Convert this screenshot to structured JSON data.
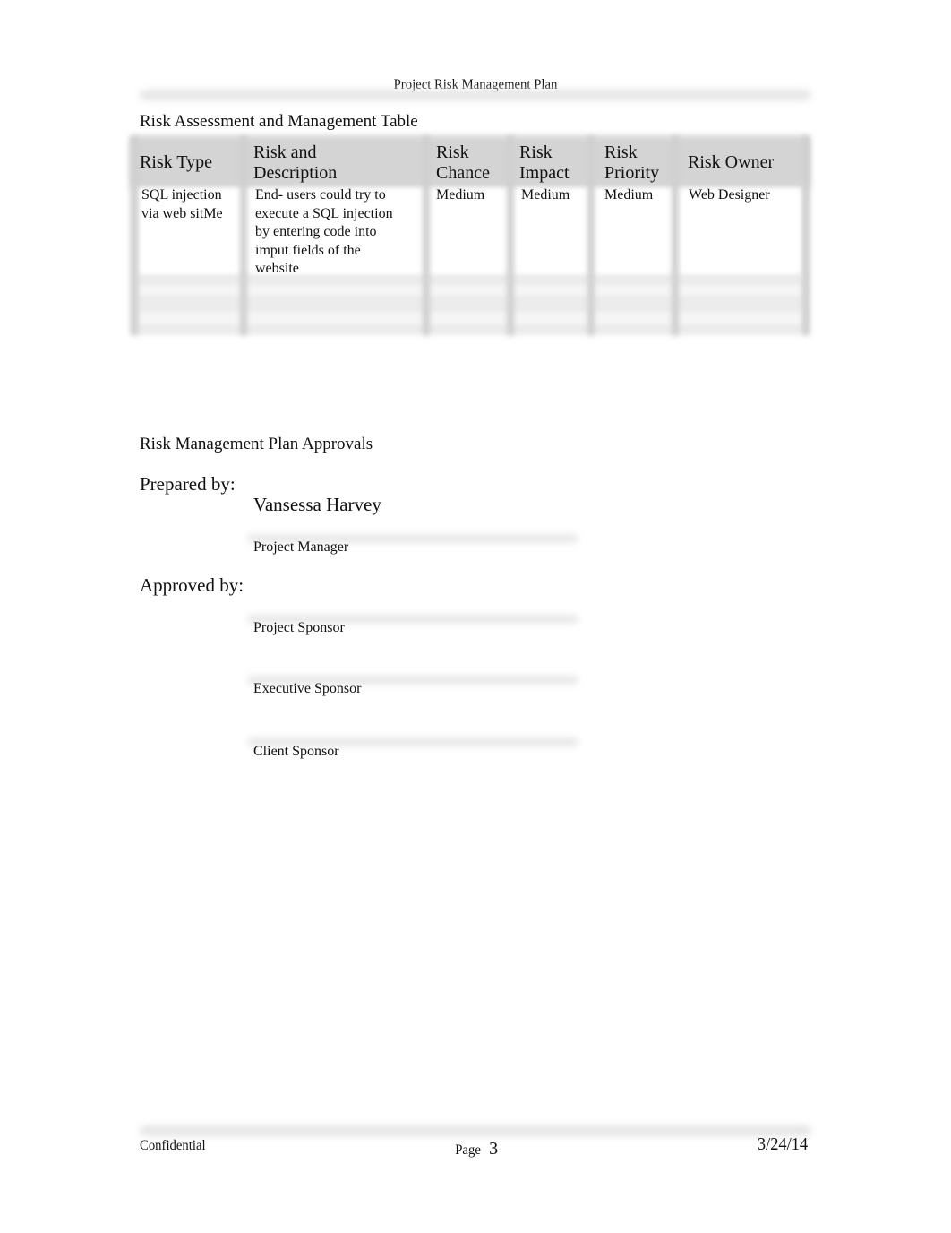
{
  "header": {
    "title": "Project Risk Management Plan"
  },
  "risk_table": {
    "title": "Risk Assessment and Management Table",
    "columns": [
      {
        "line1": "Risk Type",
        "line2": ""
      },
      {
        "line1": "Risk and",
        "line2": "Description"
      },
      {
        "line1": "Risk",
        "line2": "Chance"
      },
      {
        "line1": "Risk",
        "line2": "Impact"
      },
      {
        "line1": "Risk",
        "line2": "Priority"
      },
      {
        "line1": "Risk Owner",
        "line2": ""
      }
    ],
    "rows": [
      {
        "risk_type": [
          "SQL injection",
          "via web sitMe"
        ],
        "description": [
          "End- users could try to",
          "execute a SQL injection",
          "by entering code into",
          "imput fields of the",
          "website"
        ],
        "chance": "Medium",
        "impact": "Medium",
        "priority": "Medium",
        "owner": "Web Designer"
      },
      {
        "risk_type": [],
        "description": [],
        "chance": "",
        "impact": "",
        "priority": "",
        "owner": ""
      },
      {
        "risk_type": [],
        "description": [],
        "chance": "",
        "impact": "",
        "priority": "",
        "owner": ""
      }
    ]
  },
  "approvals": {
    "title": "Risk Management Plan Approvals",
    "prepared_by_label": "Prepared by:",
    "prepared_by_name": "Vansessa Harvey",
    "prepared_by_role": "Project Manager",
    "approved_by_label": "Approved by:",
    "signatories": [
      {
        "role": "Project Sponsor"
      },
      {
        "role": "Executive Sponsor"
      },
      {
        "role": "Client Sponsor"
      }
    ]
  },
  "footer": {
    "left": "Confidential",
    "page_label": "Page",
    "page_number": "3",
    "date": "3/24/14"
  }
}
